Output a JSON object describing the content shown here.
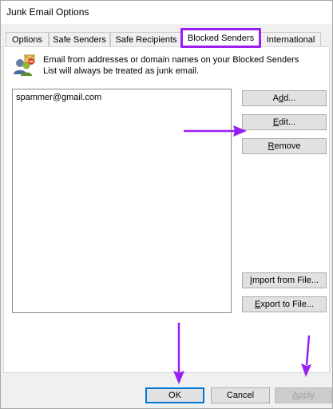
{
  "window": {
    "title": "Junk Email Options"
  },
  "tabs": [
    {
      "label": "Options"
    },
    {
      "label": "Safe Senders"
    },
    {
      "label": "Safe Recipients"
    },
    {
      "label": "Blocked Senders"
    },
    {
      "label": "International"
    }
  ],
  "active_tab": "Blocked Senders",
  "panel": {
    "description": "Email from addresses or domain names on your Blocked Senders List will always be treated as junk email.",
    "list_items": [
      "spammer@gmail.com"
    ],
    "buttons": {
      "add": {
        "pre": "A",
        "ul": "d",
        "post": "d..."
      },
      "edit": {
        "pre": "",
        "ul": "E",
        "post": "dit..."
      },
      "remove": {
        "pre": "",
        "ul": "R",
        "post": "emove"
      },
      "import": {
        "pre": "",
        "ul": "I",
        "post": "mport from File..."
      },
      "export": {
        "pre": "",
        "ul": "E",
        "post": "xport to File..."
      }
    }
  },
  "footer": {
    "ok": "OK",
    "cancel": "Cancel",
    "apply": {
      "pre": "",
      "ul": "A",
      "post": "pply"
    }
  },
  "colors": {
    "annotation": "#9b1ef2",
    "primary_border": "#0078d7"
  },
  "icons": {
    "panel_icon": "blocked-senders-icon"
  }
}
